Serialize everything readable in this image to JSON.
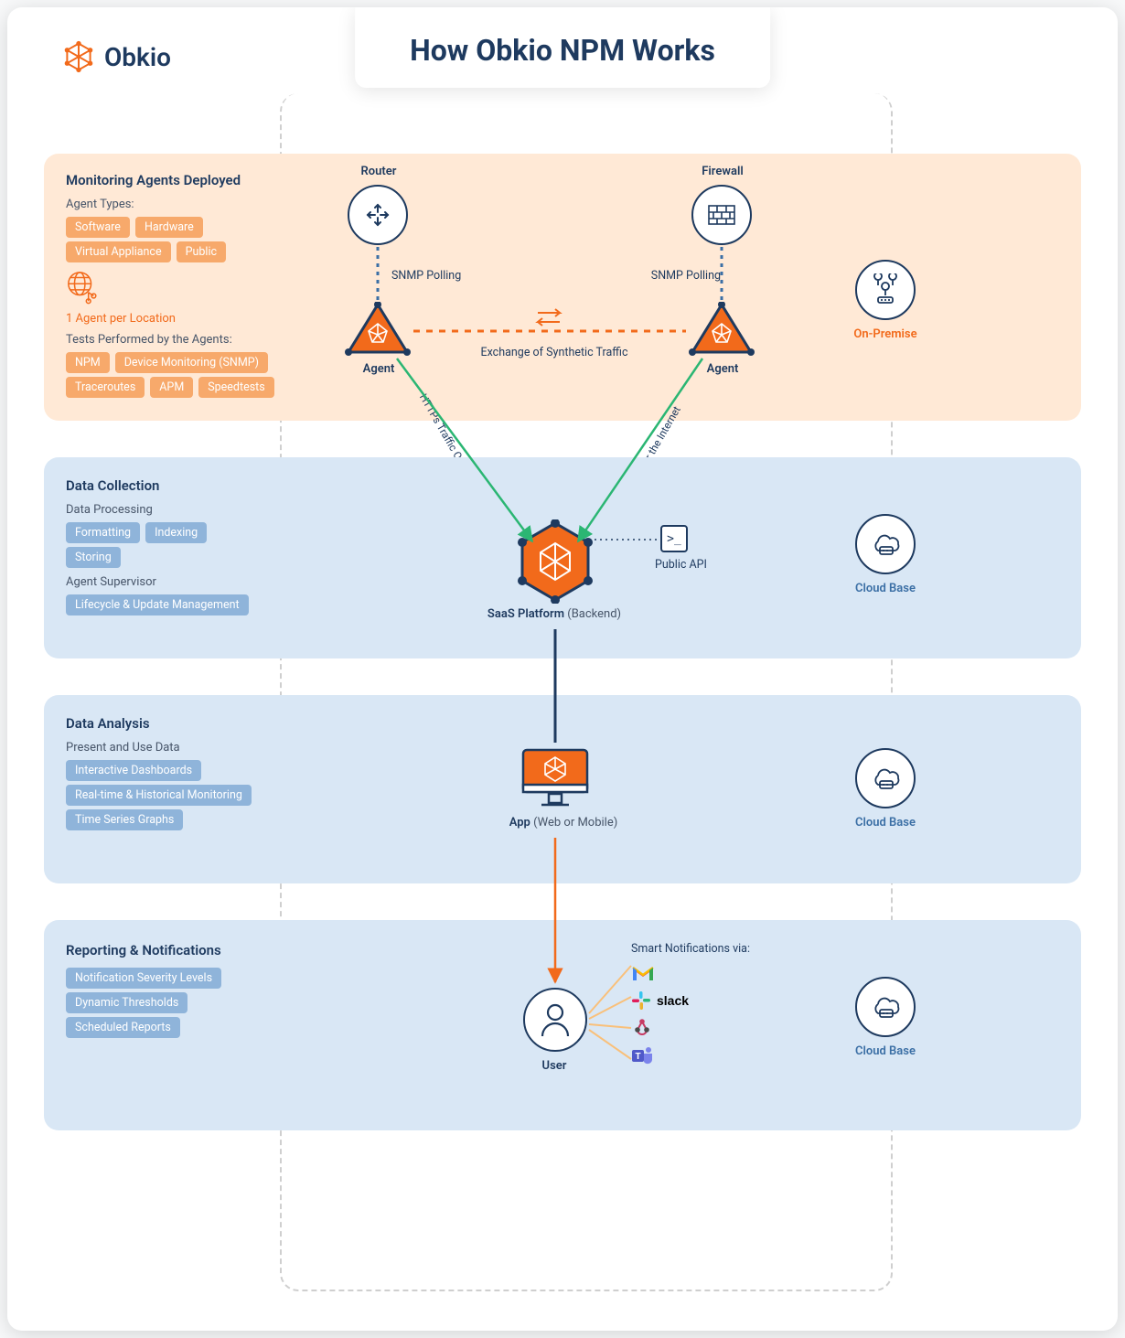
{
  "brand": "Obkio",
  "title": "How Obkio NPM Works",
  "section1": {
    "header": "Monitoring Agents Deployed",
    "sub1": "Agent Types:",
    "tags_types": [
      "Software",
      "Hardware",
      "Virtual Appliance",
      "Public"
    ],
    "note": "1 Agent per Location",
    "sub2": "Tests Performed by the Agents:",
    "tags_tests": [
      "NPM",
      "Device Monitoring (SNMP)",
      "Traceroutes",
      "APM",
      "Speedtests"
    ],
    "router": "Router",
    "firewall": "Firewall",
    "snmp": "SNMP Polling",
    "agent": "Agent",
    "exchange": "Exchange of Synthetic Traffic",
    "https": "HTTPs Traffic Over the Internet",
    "loc": "On-Premise"
  },
  "section2": {
    "header": "Data Collection",
    "sub1": "Data Processing",
    "tags1": [
      "Formatting",
      "Indexing",
      "Storing"
    ],
    "sub2": "Agent Supervisor",
    "tags2": [
      "Lifecycle & Update Management"
    ],
    "saas": "SaaS Platform",
    "saas_sub": " (Backend)",
    "api": "Public API",
    "loc": "Cloud Base"
  },
  "section3": {
    "header": "Data Analysis",
    "sub1": "Present and Use Data",
    "tags": [
      "Interactive Dashboards",
      "Real-time & Historical Monitoring",
      "Time Series Graphs"
    ],
    "app": "App",
    "app_sub": " (Web or Mobile)",
    "loc": "Cloud Base"
  },
  "section4": {
    "header": "Reporting & Notifications",
    "tags": [
      "Notification Severity Levels",
      "Dynamic Thresholds",
      "Scheduled Reports"
    ],
    "user": "User",
    "notif_header": "Smart Notifications via:",
    "notif_items": [
      "Gmail",
      "slack",
      "Webhook",
      "Teams"
    ],
    "loc": "Cloud Base"
  }
}
